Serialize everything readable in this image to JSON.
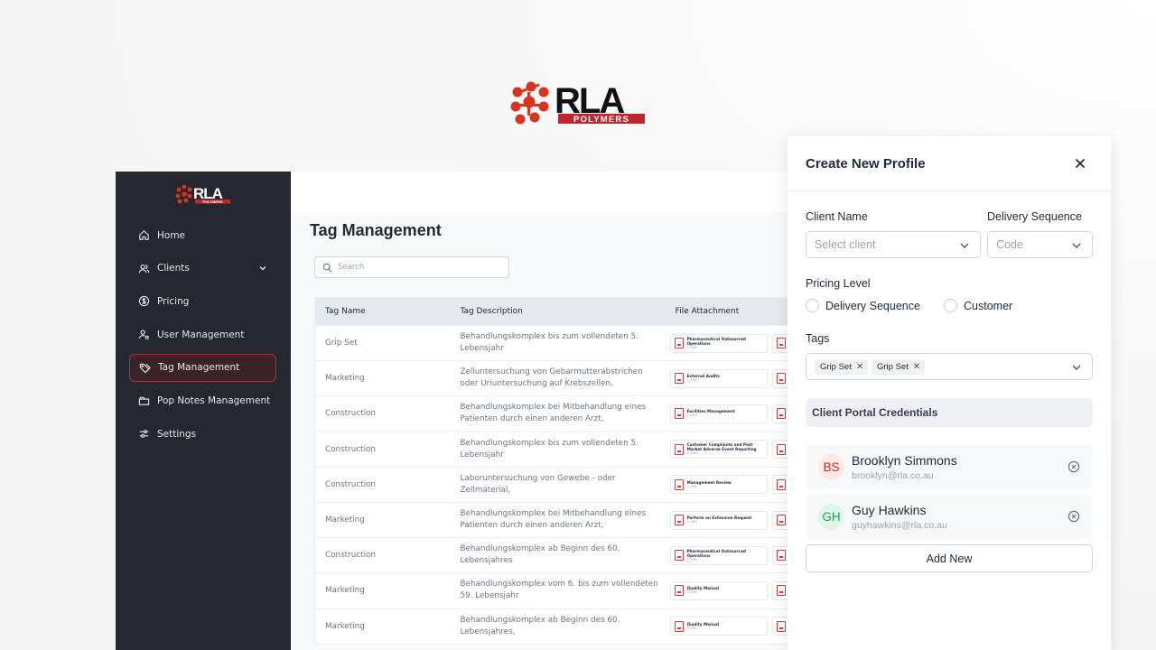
{
  "brand": {
    "logo_text": "RLA",
    "logo_sub": "POLYMERS",
    "accent": "#c0262d"
  },
  "sidebar": {
    "items": [
      {
        "label": "Home",
        "icon": "home-icon"
      },
      {
        "label": "Clients",
        "icon": "users-icon",
        "expandable": true
      },
      {
        "label": "Pricing",
        "icon": "dollar-icon"
      },
      {
        "label": "User Management",
        "icon": "user-gear-icon"
      },
      {
        "label": "Tag Management",
        "icon": "tag-icon",
        "active": true
      },
      {
        "label": "Pop Notes Management",
        "icon": "folder-icon"
      },
      {
        "label": "Settings",
        "icon": "sliders-icon"
      }
    ]
  },
  "main": {
    "title": "Tag Management",
    "search_placeholder": "Search",
    "table": {
      "headers": [
        "Tag Name",
        "Tag Description",
        "File Attachment"
      ],
      "rows": [
        {
          "name": "Grip Set",
          "desc1": "Behandlungskomplex bis zum vollendeten 5.",
          "desc2": "Lebensjahr",
          "file": "Pharmaceutical Outsourced Operations",
          "size": "1.2MB"
        },
        {
          "name": "Marketing",
          "desc1": "Zelluntersuchung von Gebarmutterabstrichen",
          "desc2": "oder Uriuntersuchung auf Krebszellen,",
          "file": "External Audits",
          "size": "1.2MB"
        },
        {
          "name": "Construction",
          "desc1": "Behandlungskomplex bei Mitbehandlung eines",
          "desc2": "Patienten durch einen anderen Arzt,",
          "file": "Facilities Management",
          "size": "1.2MB"
        },
        {
          "name": "Construction",
          "desc1": "Behandlungskomplex bis zum vollendeten 5.",
          "desc2": "Lebensjahr",
          "file": "Customer Complaints and Post Market Adverse Event Reporting",
          "size": "1.2MB"
        },
        {
          "name": "Construction",
          "desc1": "Laboruntersuchung von Gewebe - oder",
          "desc2": "Zellmaterial,",
          "file": "Management Review",
          "size": "1.2MB"
        },
        {
          "name": "Marketing",
          "desc1": "Behandlungskomplex bei Mitbehandlung eines",
          "desc2": "Patienten durch einen anderen Arzt,",
          "file": "Perform an Extension Request",
          "size": "1.2MB"
        },
        {
          "name": "Construction",
          "desc1": "Behandlungskomplex ab Beginn des 60.",
          "desc2": "Lebensjahres",
          "file": "Pharmaceutical Outsourced Operations",
          "size": "1.2MB"
        },
        {
          "name": "Marketing",
          "desc1": "Behandlungskomplex vom 6. bis zum vollendeten",
          "desc2": "59. Lebensjahr",
          "file": "Quality Manual",
          "size": "1.2MB"
        },
        {
          "name": "Marketing",
          "desc1": "Behandlungskomplex ab Beginn des 60.",
          "desc2": "Lebensjahres,",
          "file": "Quality Manual",
          "size": "1.2MB"
        }
      ]
    }
  },
  "drawer": {
    "title": "Create New Profile",
    "client_name_label": "Client Name",
    "client_placeholder": "Select client",
    "delivery_label": "Delivery Sequence",
    "delivery_placeholder": "Code",
    "pricing_label": "Pricing Level",
    "pricing_options": [
      "Delivery Sequence",
      "Customer"
    ],
    "tags_label": "Tags",
    "tags": [
      "Grip Set",
      "Grip Set"
    ],
    "credentials_label": "Client Portal Credentials",
    "credentials": [
      {
        "initials": "BS",
        "name": "Brooklyn Simmons",
        "email": "brooklyn@rla.co.au"
      },
      {
        "initials": "GH",
        "name": "Guy Hawkins",
        "email": "guyhawkins@rla.co.au"
      }
    ],
    "add_label": "Add New"
  }
}
